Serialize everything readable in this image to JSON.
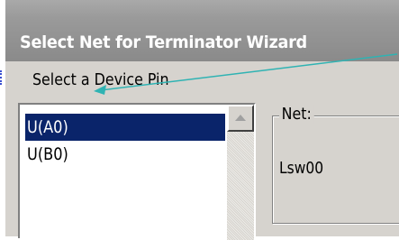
{
  "window": {
    "title": "Select Net for Terminator Wizard"
  },
  "pin_section": {
    "label": "Select a Device Pin",
    "items": [
      {
        "label": "U(A0)",
        "selected": true
      },
      {
        "label": "U(B0)",
        "selected": false
      }
    ]
  },
  "net_section": {
    "legend": "Net:",
    "value": "Lsw00"
  },
  "colors": {
    "selection": "#0a246a",
    "dialog_bg": "#d6d3ce",
    "callout": "#2fb3b3"
  },
  "icons": {
    "scroll_up": "triangle-up-icon",
    "callout": "arrow-icon"
  }
}
